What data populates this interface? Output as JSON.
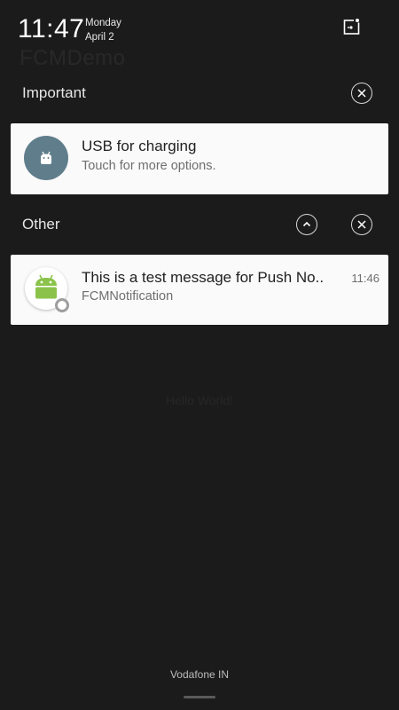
{
  "background_app": {
    "title": "FCMDemo",
    "center_text": "Hello World!"
  },
  "status": {
    "time": "11:47",
    "day": "Monday",
    "date": "April 2"
  },
  "sections": {
    "important": {
      "title": "Important"
    },
    "other": {
      "title": "Other"
    }
  },
  "notifications": [
    {
      "title": "USB for charging",
      "text": "Touch for more options.",
      "icon": "usb-android-icon",
      "icon_color": "#607d8b"
    },
    {
      "title": "This is a test message for Push No..",
      "text": "FCMNotification",
      "time": "11:46",
      "icon": "android-robot-icon",
      "icon_color": "#8bc34a"
    }
  ],
  "footer": {
    "carrier": "Vodafone IN"
  }
}
